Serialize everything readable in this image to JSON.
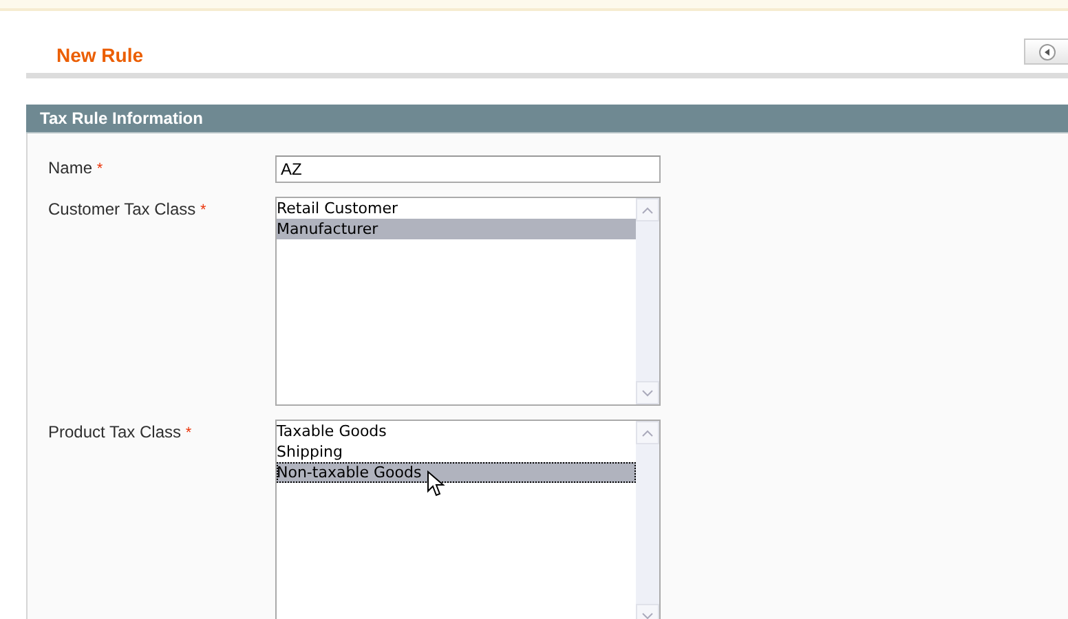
{
  "page_title": "New Rule",
  "section": {
    "title": "Tax Rule Information",
    "fields": [
      {
        "kind": "text",
        "label": "Name",
        "required_mark": "*",
        "value": "AZ"
      },
      {
        "kind": "multiselect",
        "label": "Customer Tax Class",
        "required_mark": "*",
        "options": [
          {
            "label": "Retail Customer",
            "selected": false,
            "focused": false
          },
          {
            "label": "Manufacturer",
            "selected": true,
            "focused": false
          }
        ]
      },
      {
        "kind": "multiselect",
        "label": "Product Tax Class",
        "required_mark": "*",
        "options": [
          {
            "label": "Taxable Goods",
            "selected": false,
            "focused": false
          },
          {
            "label": "Shipping",
            "selected": false,
            "focused": false
          },
          {
            "label": "Non-taxable Goods",
            "selected": true,
            "focused": true
          }
        ]
      }
    ]
  }
}
